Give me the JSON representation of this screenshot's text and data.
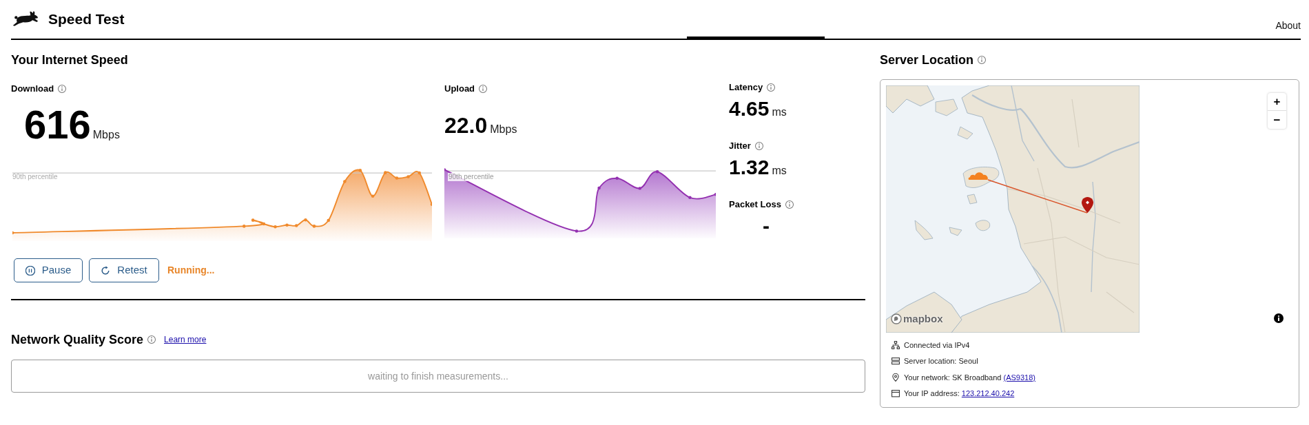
{
  "header": {
    "title": "Speed Test",
    "nav": [
      {
        "label": "About"
      }
    ]
  },
  "speed": {
    "title": "Your Internet Speed",
    "download": {
      "label": "Download",
      "value": "616",
      "unit": "Mbps",
      "percentile_label": "90th percentile"
    },
    "upload": {
      "label": "Upload",
      "value": "22.0",
      "unit": "Mbps",
      "percentile_label": "90th percentile"
    },
    "metrics": [
      {
        "label": "Latency",
        "value": "4.65",
        "unit": "ms"
      },
      {
        "label": "Jitter",
        "value": "1.32",
        "unit": "ms"
      },
      {
        "label": "Packet Loss",
        "value": "-"
      }
    ],
    "buttons": [
      {
        "kind": "pause",
        "label": "Pause"
      },
      {
        "kind": "retest",
        "label": "Retest"
      }
    ],
    "status": "Running..."
  },
  "quality": {
    "title": "Network Quality Score",
    "link": "Learn more",
    "message": "waiting to finish measurements..."
  },
  "server": {
    "title": "Server Location",
    "map": {
      "zoom_in": "+",
      "zoom_out": "−",
      "attribution": "mapbox"
    },
    "details": [
      {
        "kind": "connection",
        "text": "Connected via IPv4"
      },
      {
        "kind": "server",
        "text": "Server location: Seoul"
      },
      {
        "kind": "network",
        "text": "Your network: SK Broadband",
        "link": "(AS9318)"
      },
      {
        "kind": "address",
        "text": "Your IP address:",
        "link": "123.212.40.242"
      }
    ]
  }
}
